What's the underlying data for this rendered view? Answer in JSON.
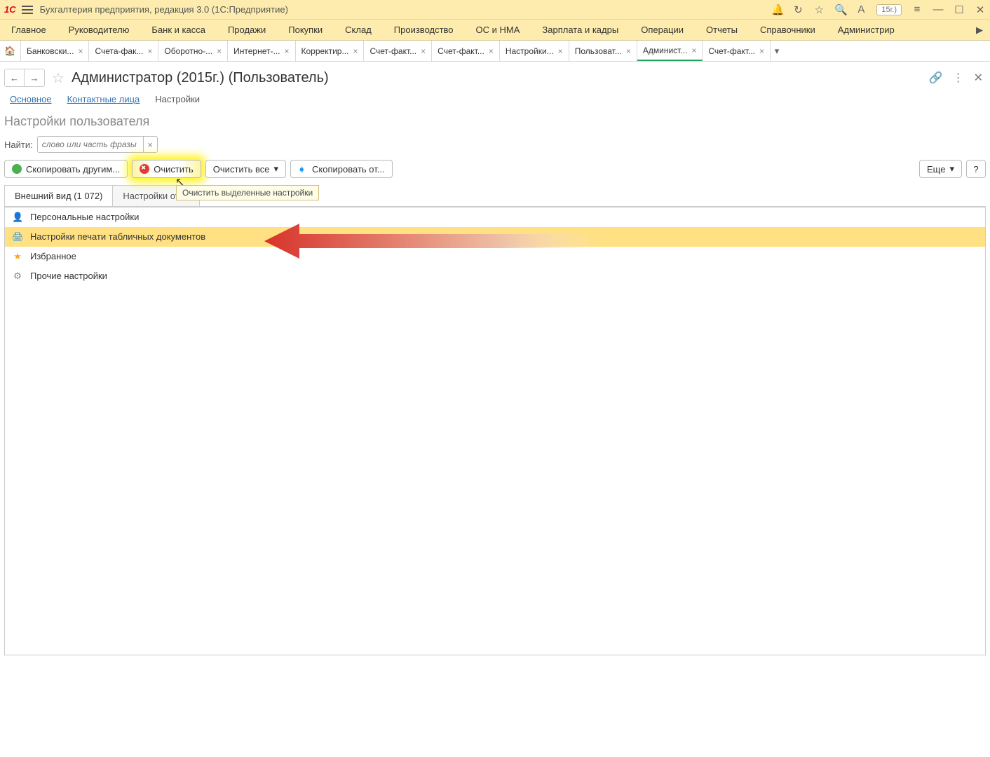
{
  "titlebar": {
    "app": "Бухгалтерия предприятия, редакция 3.0  (1С:Предприятие)",
    "chip": "15г.)"
  },
  "menu": [
    "Главное",
    "Руководителю",
    "Банк и касса",
    "Продажи",
    "Покупки",
    "Склад",
    "Производство",
    "ОС и НМА",
    "Зарплата и кадры",
    "Операции",
    "Отчеты",
    "Справочники",
    "Администрир"
  ],
  "tabs": [
    {
      "label": "Банковски..."
    },
    {
      "label": "Счета-фак..."
    },
    {
      "label": "Оборотно-..."
    },
    {
      "label": "Интернет-..."
    },
    {
      "label": "Корректир..."
    },
    {
      "label": "Счет-факт..."
    },
    {
      "label": "Счет-факт..."
    },
    {
      "label": "Настройки..."
    },
    {
      "label": "Пользоват..."
    },
    {
      "label": "Админист...",
      "active": true
    },
    {
      "label": "Счет-факт..."
    }
  ],
  "page": {
    "title": "Администратор (2015г.) (Пользователь)"
  },
  "subnav": {
    "a": "Основное",
    "b": "Контактные лица",
    "c": "Настройки"
  },
  "section": {
    "title": "Настройки пользователя",
    "search_label": "Найти:",
    "search_ph": "слово или часть фразы"
  },
  "toolbar": {
    "copy_to": "Скопировать другим...",
    "clear": "Очистить",
    "clear_all": "Очистить все",
    "copy_from": "Скопировать от...",
    "more": "Еще",
    "help": "?",
    "tooltip": "Очистить выделенные настройки"
  },
  "inner_tabs": {
    "a": "Внешний вид (1 072)",
    "b": "Настройки отче"
  },
  "rows": [
    {
      "icon": "👤",
      "color": "#2196f3",
      "label": "Персональные настройки"
    },
    {
      "icon": "🖨",
      "color": "#1e88e5",
      "label": "Настройки печати табличных документов",
      "sel": true
    },
    {
      "icon": "★",
      "color": "#f9a825",
      "label": "Избранное"
    },
    {
      "icon": "⚙",
      "color": "#888",
      "label": "Прочие настройки"
    }
  ]
}
